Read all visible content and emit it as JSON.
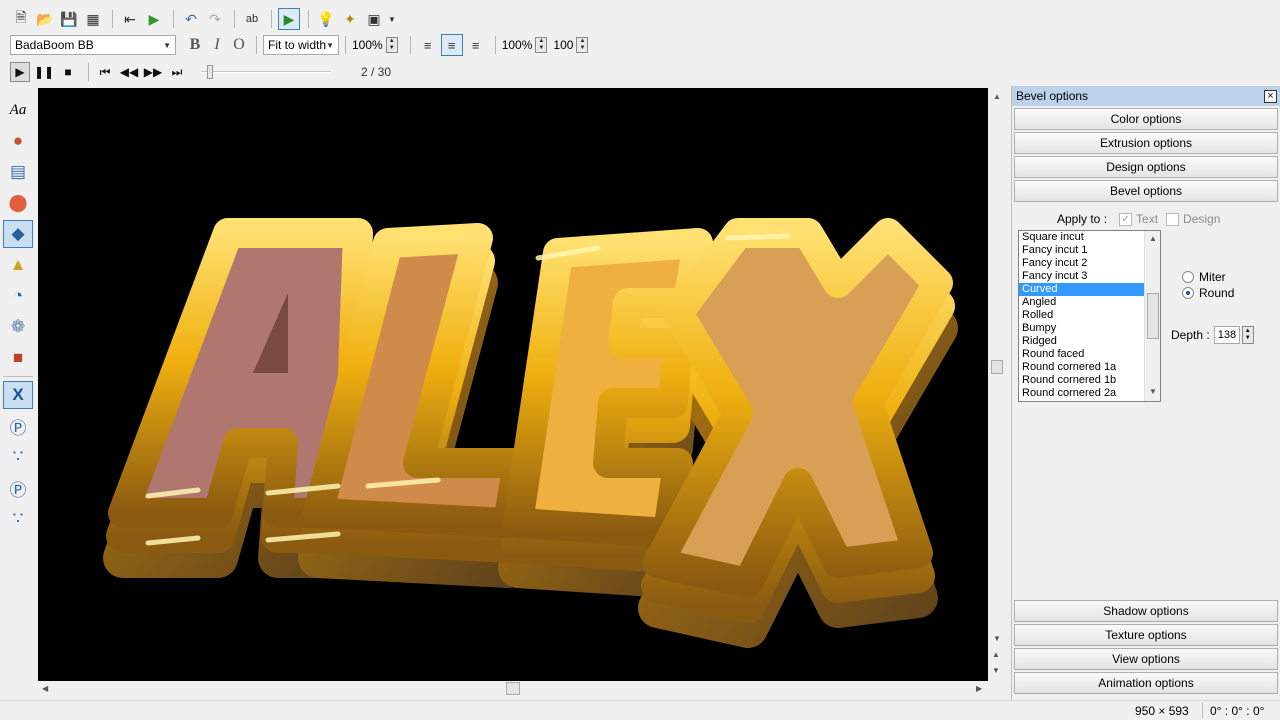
{
  "toolbar1": {
    "icons": [
      "new-icon",
      "open-icon",
      "save-icon",
      "save-all-icon",
      "import-icon",
      "export-icon",
      "undo-icon",
      "redo-icon",
      "spellcheck-icon",
      "animation-icon",
      "bulb-icon",
      "wand-icon",
      "window-icon"
    ]
  },
  "toolbar2": {
    "font": "BadaBoom BB",
    "bold": "B",
    "italic": "I",
    "outline": "O",
    "fit": "Fit to width",
    "zoom1": "100%",
    "zoom2": "100%",
    "zoom3": "100"
  },
  "playback": {
    "frame": "2 / 30"
  },
  "canvas": {
    "text": "ALEX",
    "background": "#000000",
    "letter_colors": [
      "#b07670",
      "#d08a4a",
      "#f0b040",
      "#d8a055"
    ],
    "bevel_color": "#f0b010"
  },
  "panel": {
    "title": "Bevel options",
    "sections_top": [
      "Color options",
      "Extrusion options",
      "Design options",
      "Bevel options"
    ],
    "apply_to": "Apply to :",
    "apply_text": "Text",
    "apply_design": "Design",
    "bevel_list": [
      "Square incut",
      "Fancy incut 1",
      "Fancy incut 2",
      "Fancy incut 3",
      "Curved",
      "Angled",
      "Rolled",
      "Bumpy",
      "Ridged",
      "Round faced",
      "Round cornered 1a",
      "Round cornered 1b",
      "Round cornered 2a"
    ],
    "selected_index": 4,
    "miter": "Miter",
    "round": "Round",
    "corner_mode": "Round",
    "depth_label": "Depth :",
    "depth_value": "138",
    "sections_bottom": [
      "Shadow options",
      "Texture options",
      "View options",
      "Animation options"
    ]
  },
  "status": {
    "size": "950 × 593",
    "rotation": "0° : 0° : 0°"
  },
  "colors": {
    "accent": "#3399ff",
    "panel_title": "#bcd1ea"
  }
}
